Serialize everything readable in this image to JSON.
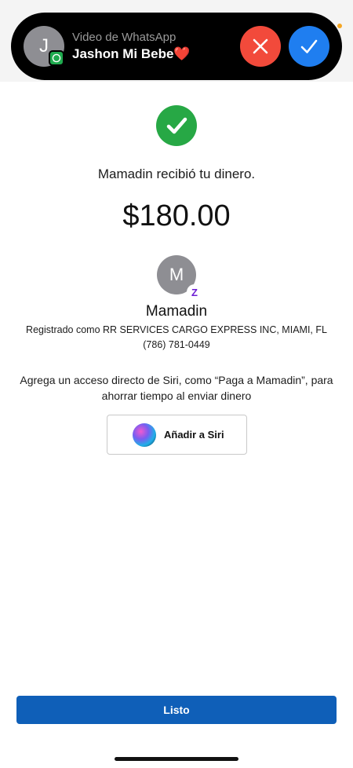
{
  "call_banner": {
    "avatar_initial": "J",
    "subtitle": "Video de WhatsApp",
    "caller_name": "Jashon Mi Bebe❤️",
    "icons": {
      "badge": "whatsapp-icon",
      "decline": "close-icon",
      "accept": "checkmark-icon"
    },
    "colors": {
      "decline": "#f24a3b",
      "accept": "#1f7ef0"
    }
  },
  "confirmation": {
    "icon": "checkmark-circle-icon",
    "message": "Mamadin recibió tu dinero.",
    "amount": "$180.00"
  },
  "recipient": {
    "avatar_initial": "M",
    "badge": "zelle-icon",
    "badge_glyph": "Z",
    "name": "Mamadin",
    "registered": "Registrado como RR SERVICES CARGO EXPRESS INC, MIAMI, FL",
    "phone": "(786) 781-0449"
  },
  "siri": {
    "prompt": "Agrega un acceso directo de Siri, como “Paga a Mamadin”, para ahorrar tiempo al enviar dinero",
    "button_label": "Añadir a Siri",
    "icon": "siri-icon"
  },
  "footer": {
    "done_label": "Listo",
    "done_color": "#0f5fb8"
  }
}
